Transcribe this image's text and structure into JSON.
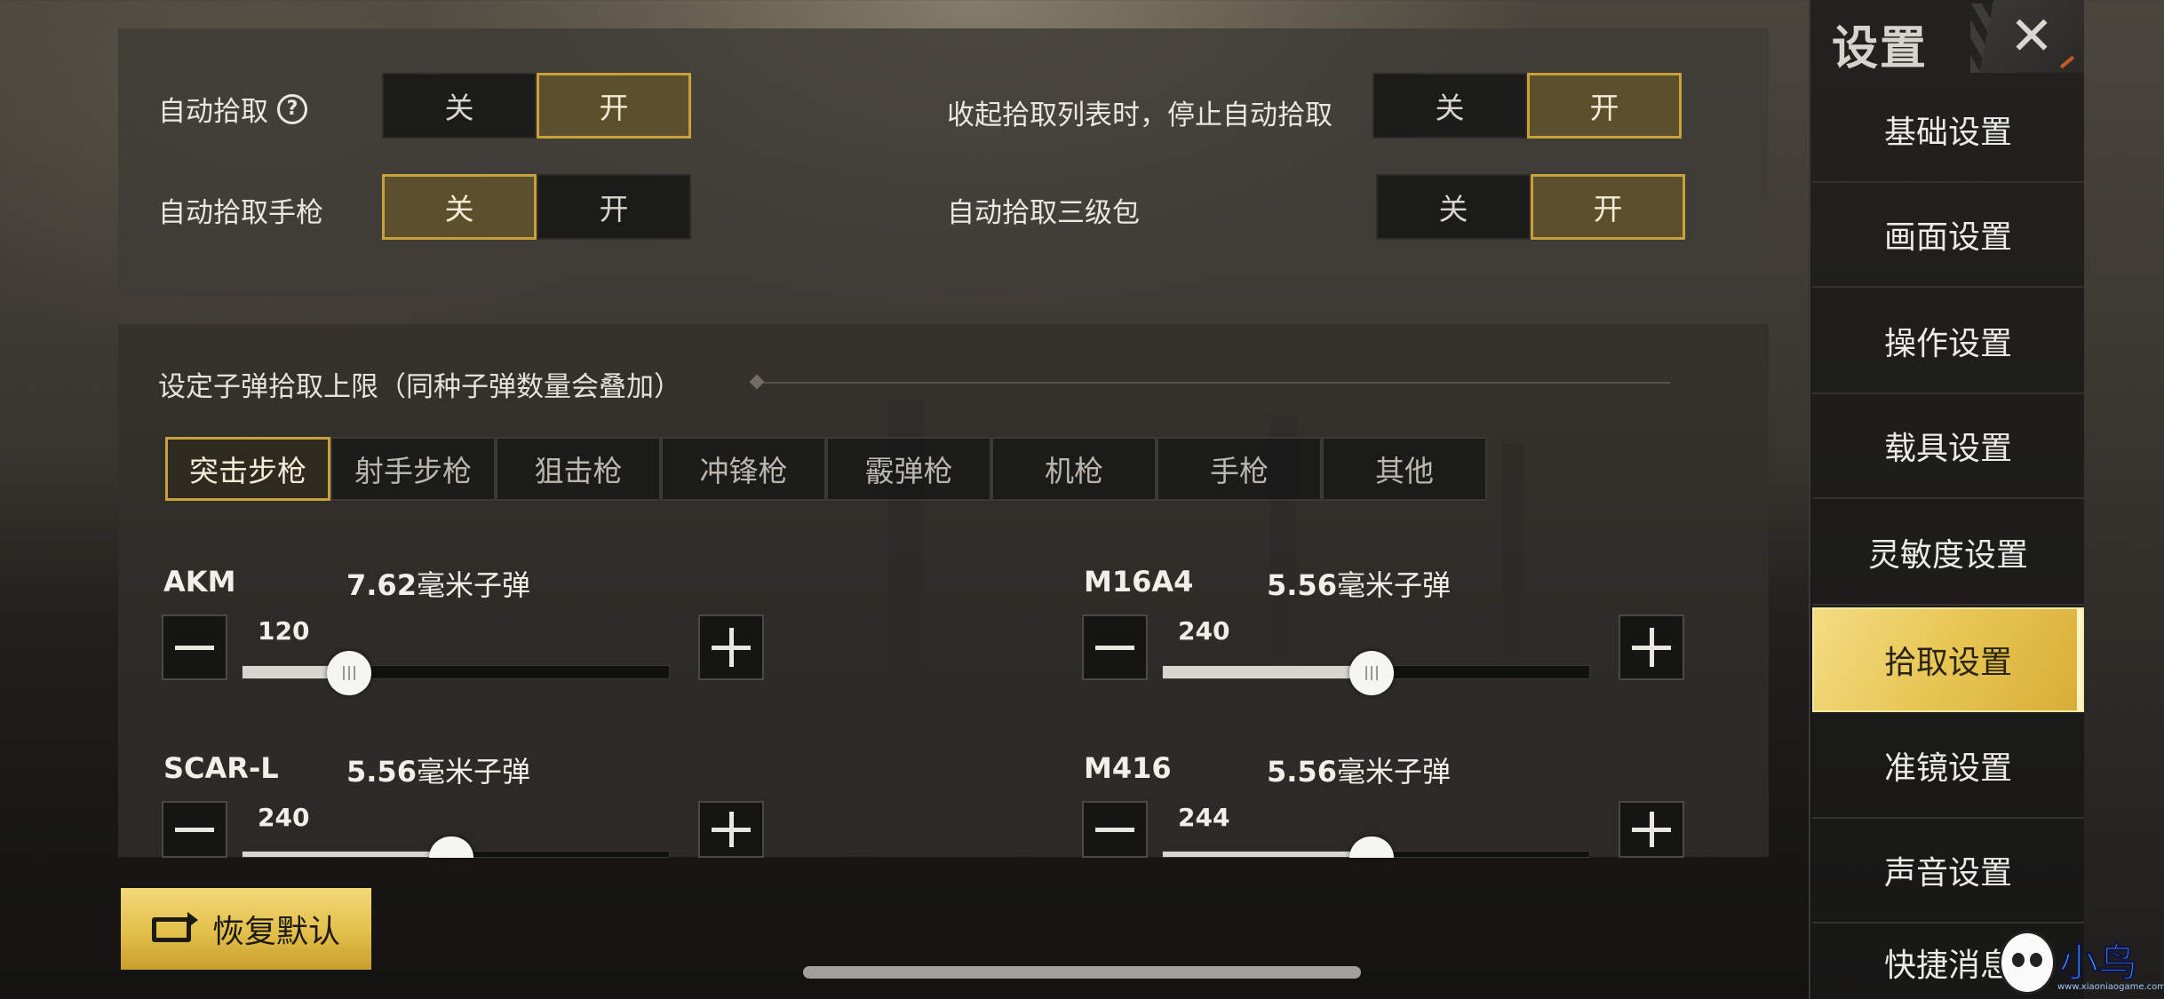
{
  "top_settings": {
    "auto_pickup": {
      "label": "自动拾取",
      "help_icon": "?",
      "off": "关",
      "on": "开",
      "value": "开"
    },
    "auto_pickup_pistol": {
      "label": "自动拾取手枪",
      "off": "关",
      "on": "开",
      "value": "关"
    },
    "stop_on_collapse": {
      "label": "收起拾取列表时，停止自动拾取",
      "off": "关",
      "on": "开",
      "value": "开"
    },
    "auto_pickup_lv3_bag": {
      "label": "自动拾取三级包",
      "off": "关",
      "on": "开",
      "value": "开"
    }
  },
  "ammo_limit": {
    "title": "设定子弹拾取上限（同种子弹数量会叠加）",
    "tabs": [
      "突击步枪",
      "射手步枪",
      "狙击枪",
      "冲锋枪",
      "霰弹枪",
      "机枪",
      "手枪",
      "其他"
    ],
    "active_tab": "突击步枪",
    "weapons": [
      {
        "name": "AKM",
        "ammo_num": "7.62",
        "ammo_unit": "毫米子弹",
        "value": "120",
        "fraction": 0.25
      },
      {
        "name": "M16A4",
        "ammo_num": "5.56",
        "ammo_unit": "毫米子弹",
        "value": "240",
        "fraction": 0.49
      },
      {
        "name": "SCAR-L",
        "ammo_num": "5.56",
        "ammo_unit": "毫米子弹",
        "value": "240",
        "fraction": 0.49
      },
      {
        "name": "M416",
        "ammo_num": "5.56",
        "ammo_unit": "毫米子弹",
        "value": "244",
        "fraction": 0.49
      }
    ]
  },
  "restore_button": {
    "label": "恢复默认",
    "icon": "restore-icon"
  },
  "sidebar": {
    "title": "设置",
    "close_icon": "✕",
    "items": [
      "基础设置",
      "画面设置",
      "操作设置",
      "载具设置",
      "灵敏度设置",
      "拾取设置",
      "准镜设置",
      "声音设置",
      "快捷消息"
    ],
    "active": "拾取设置"
  },
  "watermark": {
    "mark": "小鸟",
    "url": "www.xiaoniaogame.com"
  },
  "colors": {
    "accent_gold": "#c9a13a",
    "active_item": "#e7c553",
    "toggle_on_bg": "#5b4f2c"
  }
}
